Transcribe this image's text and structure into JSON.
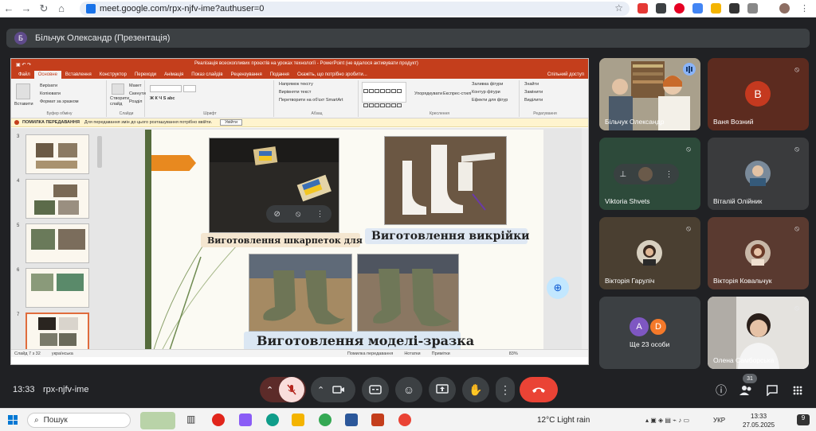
{
  "browser": {
    "url": "meet.google.com/rpx-njfv-ime?authuser=0"
  },
  "meet": {
    "presenter_initial": "Б",
    "presenter_title": "Більчук Олександр (Презентація)",
    "time": "13:33",
    "code": "rpx-njfv-ime",
    "participant_count": "31"
  },
  "ppt": {
    "window_title": "Реалізація всеохопливих проєктів на уроках технології - PowerPoint (не вдалося активувати продукт)",
    "tabs": [
      "Файл",
      "Основне",
      "Вставлення",
      "Конструктор",
      "Переходи",
      "Анімація",
      "Показ слайдів",
      "Рецензування",
      "Подання",
      "Скажіть, що потрібно зробити..."
    ],
    "share_label": "Спільний доступ",
    "ribbon": {
      "paste": "Вставити",
      "cut": "Вирізати",
      "copy": "Копіювати",
      "format_painter": "Формат за зразком",
      "clipboard_group": "Буфер обміну",
      "new_slide": "Створити слайд",
      "layout": "Макет",
      "reset": "Скинути",
      "section": "Розділ",
      "slides_group": "Слайди",
      "font_group": "Шрифт",
      "text_direction": "Напрямок тексту",
      "align_text": "Вирівняти текст",
      "convert_smartart": "Перетворити на об'єкт SmartArt",
      "paragraph_group": "Абзац",
      "arrange": "Упорядкувати",
      "quick_styles": "Експрес-стилі",
      "drawing_group": "Креслення",
      "fill": "Заливка фігури",
      "outline": "Контур фігури",
      "effects": "Ефекти для фігур",
      "find": "Знайти",
      "replace": "Замінити",
      "select": "Виділити",
      "editing_group": "Редагування"
    },
    "warning": {
      "title": "ПОМИЛКА ПЕРЕДАВАННЯ",
      "message": "Для передавання змін до цього розташування потрібно ввійти.",
      "button": "Увійти"
    },
    "thumbnails": [
      "3",
      "4",
      "5",
      "6",
      "7"
    ],
    "slide": {
      "caption1": "Виготовлення шкарпеток для ЗСУ",
      "caption2": "Виготовлення викрійки",
      "caption3": "Виготовлення моделі-зразка"
    },
    "status": {
      "slide_count": "Слайд 7 з 32",
      "language": "українська",
      "upload_error": "Помилка передавання",
      "notes": "Нотатки",
      "comments": "Примітки",
      "zoom": "83%"
    }
  },
  "participants": [
    {
      "name": "Більчук Олександр"
    },
    {
      "name": "Ваня Возний",
      "initial": "В",
      "color": "#c5391f"
    },
    {
      "name": "Viktoria Shvets"
    },
    {
      "name": "Віталій Олійник"
    },
    {
      "name": "Вікторія Гаруліч"
    },
    {
      "name": "Вікторія Ковальчук"
    },
    {
      "name": "Ще 23 особи",
      "initials": [
        "A",
        "D"
      ]
    },
    {
      "name": "Олена Самборська"
    }
  ],
  "taskbar": {
    "search": "Пошук",
    "weather": "12°C  Light rain",
    "lang": "УКР",
    "time": "13:33",
    "date": "27.05.2025",
    "notif": "9"
  }
}
